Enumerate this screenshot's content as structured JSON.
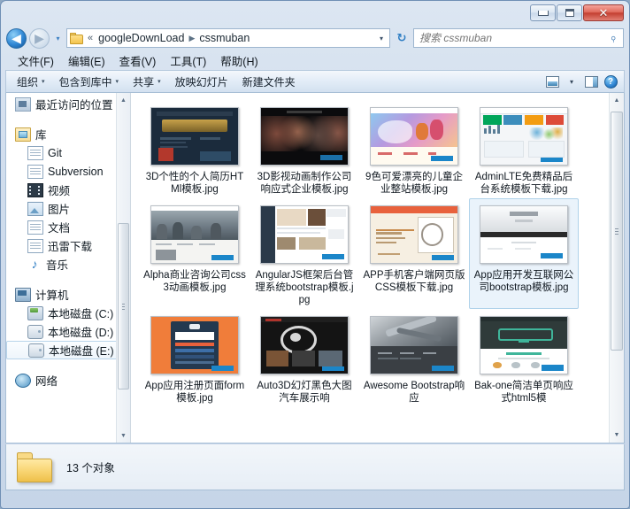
{
  "window": {
    "controls": {
      "minimize": "minimize-button",
      "maximize": "maximize-button",
      "close_label": "✕"
    }
  },
  "address_bar": {
    "back_glyph": "◀",
    "forward_glyph": "▶",
    "history_glyph": "▾",
    "separator": "«",
    "crumbs": [
      "googleDownLoad",
      "cssmuban"
    ],
    "crumb_arrow": "▶",
    "dropdown_glyph": "▾",
    "refresh_glyph": "↻"
  },
  "search": {
    "placeholder": "搜索 cssmuban",
    "value": "",
    "icon_glyph": "⌕"
  },
  "menu": {
    "items": [
      {
        "label": "文件(F)"
      },
      {
        "label": "编辑(E)"
      },
      {
        "label": "查看(V)"
      },
      {
        "label": "工具(T)"
      },
      {
        "label": "帮助(H)"
      }
    ]
  },
  "toolbar": {
    "items": [
      {
        "label": "组织",
        "has_arrow": true,
        "arrow": "▾"
      },
      {
        "label": "包含到库中",
        "has_arrow": true,
        "arrow": "▾"
      },
      {
        "label": "共享",
        "has_arrow": true,
        "arrow": "▾"
      },
      {
        "label": "放映幻灯片",
        "has_arrow": false,
        "arrow": ""
      },
      {
        "label": "新建文件夹",
        "has_arrow": false,
        "arrow": ""
      }
    ],
    "view_arrow": "▾",
    "help_label": "?"
  },
  "sidebar": {
    "items": [
      {
        "label": "最近访问的位置",
        "icon": "recent-icon",
        "indent": false,
        "selected": false
      },
      {
        "label": "库",
        "icon": "library-icon",
        "indent": false,
        "selected": false
      },
      {
        "label": "Git",
        "icon": "folder-doc-icon",
        "indent": true,
        "selected": false
      },
      {
        "label": "Subversion",
        "icon": "folder-doc-icon",
        "indent": true,
        "selected": false
      },
      {
        "label": "视频",
        "icon": "video-icon",
        "indent": true,
        "selected": false
      },
      {
        "label": "图片",
        "icon": "picture-icon",
        "indent": true,
        "selected": false
      },
      {
        "label": "文档",
        "icon": "document-icon",
        "indent": true,
        "selected": false
      },
      {
        "label": "迅雷下载",
        "icon": "folder-doc-icon",
        "indent": true,
        "selected": false
      },
      {
        "label": "音乐",
        "icon": "music-icon",
        "indent": true,
        "selected": false
      },
      {
        "label": "计算机",
        "icon": "computer-icon",
        "indent": false,
        "selected": false
      },
      {
        "label": "本地磁盘 (C:)",
        "icon": "system-drive-icon",
        "indent": true,
        "selected": false
      },
      {
        "label": "本地磁盘 (D:)",
        "icon": "drive-icon",
        "indent": true,
        "selected": false
      },
      {
        "label": "本地磁盘 (E:)",
        "icon": "drive-icon",
        "indent": true,
        "selected": true
      },
      {
        "label": "网络",
        "icon": "network-icon",
        "indent": false,
        "selected": false
      }
    ],
    "scroll_up_glyph": "▲",
    "scroll_down_glyph": "▼"
  },
  "files": {
    "items": [
      {
        "name": "3D个性的个人简历HTMl模板.jpg",
        "selected": false,
        "thumb": {
          "bg": "#1b2b3c",
          "accent": "#c8a24a",
          "style": "dark-gold"
        }
      },
      {
        "name": "3D影视动画制作公司响应式企业模板.jpg",
        "selected": false,
        "thumb": {
          "bg": "#0b0b0d",
          "accent": "#8a5a4a",
          "style": "dark-film"
        }
      },
      {
        "name": "9色可爱漂亮的儿童企业整站模板.jpg",
        "selected": false,
        "thumb": {
          "bg": "#f3f0fa",
          "accent": "#7f63c8",
          "style": "colorful-kids"
        }
      },
      {
        "name": "AdminLTE免费精品后台系统模板下载.jpg",
        "selected": false,
        "thumb": {
          "bg": "#f4f6f8",
          "accent": "#3c8dbc",
          "style": "dashboard"
        }
      },
      {
        "name": "Alpha商业咨询公司css3动画模板.jpg",
        "selected": false,
        "thumb": {
          "bg": "#e8e6e2",
          "accent": "#6b7a88",
          "style": "photo-crowd"
        }
      },
      {
        "name": "AngularJS框架后台管理系统bootstrap模板.jpg",
        "selected": false,
        "thumb": {
          "bg": "#ffffff",
          "accent": "#2b3a4a",
          "style": "admin-sidebar"
        }
      },
      {
        "name": "APP手机客户端网页版CSS模板下载.jpg",
        "selected": false,
        "thumb": {
          "bg": "#f6efe2",
          "accent": "#e8613c",
          "style": "appliance"
        }
      },
      {
        "name": "App应用开发互联网公司bootstrap模板.jpg",
        "selected": true,
        "thumb": {
          "bg": "#eef0f2",
          "accent": "#2a2a2a",
          "style": "light-hero"
        }
      },
      {
        "name": "App应用注册页面form模板.jpg",
        "selected": false,
        "thumb": {
          "bg": "#f07d3a",
          "accent": "#24394f",
          "style": "orange-form"
        }
      },
      {
        "name": "Auto3D幻灯黑色大图汽车展示响",
        "selected": false,
        "thumb": {
          "bg": "#141414",
          "accent": "#d8d8d8",
          "style": "dark-car"
        }
      },
      {
        "name": "Awesome Bootstrap响应",
        "selected": false,
        "thumb": {
          "bg": "#3a3f44",
          "accent": "#aeb4ba",
          "style": "gray-tools"
        }
      },
      {
        "name": "Bak-one简洁单页响应式html5模",
        "selected": false,
        "thumb": {
          "bg": "#2f3b3a",
          "accent": "#3fb59a",
          "style": "teal-dark"
        }
      }
    ]
  },
  "status": {
    "text": "13 个对象"
  }
}
